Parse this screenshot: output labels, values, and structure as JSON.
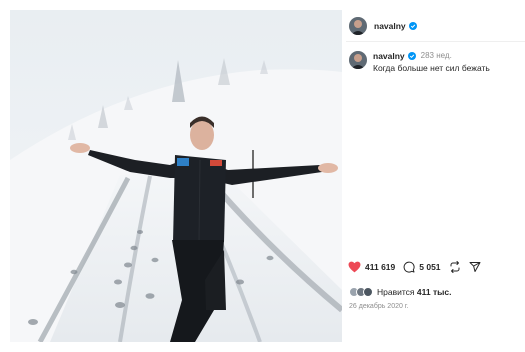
{
  "post": {
    "username": "navalny",
    "time_ago": "283 нед.",
    "caption": "Когда больше нет сил бежать",
    "photo_alt": "Человек в чёрном спортивном костюме бежит по заснеженной дороге, раскинув руки"
  },
  "actions": {
    "like_count": "411 619",
    "comment_count": "5 051"
  },
  "likes": {
    "prefix": "Нравится",
    "count": "411 тыс."
  },
  "date": "26 декабрь 2020 г.",
  "colors": {
    "heart": "#ed4956",
    "verified": "#0095f6",
    "muted": "#8e8e8e"
  },
  "icons": [
    "heart-icon",
    "comment-icon",
    "repost-icon",
    "share-icon",
    "verified-badge-icon"
  ]
}
